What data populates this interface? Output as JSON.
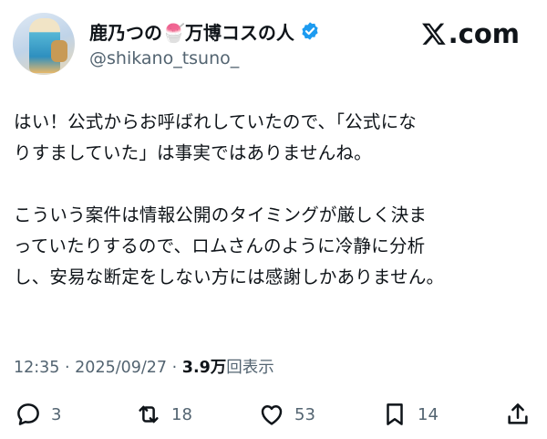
{
  "user": {
    "name": "鹿乃つの🍧万博コスの人",
    "handle": "@shikano_tsuno_",
    "avatar_icon": "cosplay-avatar"
  },
  "brand": {
    "logo_text": ".com",
    "logo_icon": "x-logo-icon"
  },
  "post": {
    "text": "はい！公式からお呼ばれしていたので、「公式にな\nりすましていた」は事実ではありませんね。\n\nこういう案件は情報公開のタイミングが厳しく決ま\nっていたりするので、ロムさんのように冷静に分析\nし、安易な断定をしない方には感謝しかありません。",
    "time": "12:35",
    "separator": "·",
    "date": "2025/09/27",
    "view_count": "3.9万",
    "view_label": "回表示"
  },
  "actions": {
    "replies": "3",
    "reposts": "18",
    "likes": "53",
    "bookmarks": "14"
  },
  "colors": {
    "text": "#0f1419",
    "muted": "#536471",
    "verified": "#1d9bf0"
  }
}
